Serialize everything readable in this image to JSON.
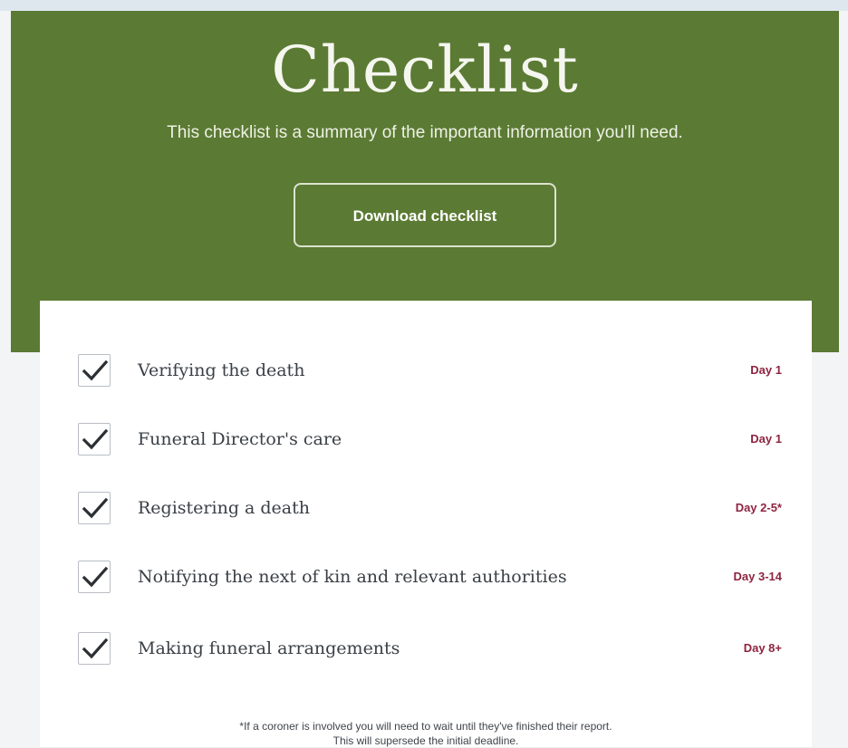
{
  "header": {
    "title": "Checklist",
    "subtitle": "This checklist is a summary of the important information you'll need.",
    "download_label": "Download checklist"
  },
  "checklist": {
    "items": [
      {
        "label": "Verifying the death",
        "day": "Day 1",
        "checked": true
      },
      {
        "label": "Funeral Director's care",
        "day": "Day 1",
        "checked": true
      },
      {
        "label": "Registering a death",
        "day": "Day 2-5*",
        "checked": true
      },
      {
        "label": "Notifying the next of kin and relevant authorities",
        "day": "Day 3-14",
        "checked": true
      },
      {
        "label": "Making funeral arrangements",
        "day": "Day 8+",
        "checked": true
      }
    ],
    "footnote_line1": "*If a coroner is involved you will need to wait until they've finished their report.",
    "footnote_line2": "This will supersede the initial deadline."
  },
  "colors": {
    "hero_green": "#5b7a33",
    "day_accent": "#8e2440",
    "page_background": "#f2f4f6"
  },
  "icons": {
    "checkbox": "check-icon"
  }
}
